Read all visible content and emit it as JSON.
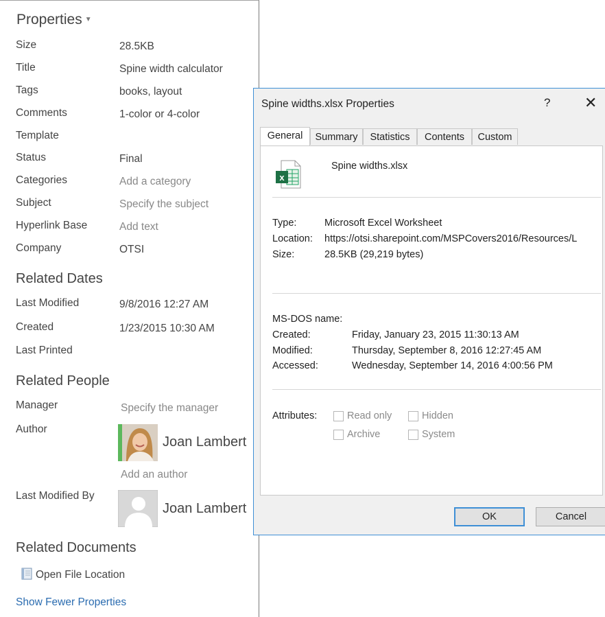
{
  "panel": {
    "title": "Properties",
    "properties": [
      {
        "label": "Size",
        "value": "28.5KB",
        "placeholder": false
      },
      {
        "label": "Title",
        "value": "Spine width calculator",
        "placeholder": false
      },
      {
        "label": "Tags",
        "value": "books, layout",
        "placeholder": false
      },
      {
        "label": "Comments",
        "value": "1-color or 4-color",
        "placeholder": false
      },
      {
        "label": "Template",
        "value": "",
        "placeholder": false
      },
      {
        "label": "Status",
        "value": "Final",
        "placeholder": false
      },
      {
        "label": "Categories",
        "value": "Add a category",
        "placeholder": true
      },
      {
        "label": "Subject",
        "value": "Specify the subject",
        "placeholder": true
      },
      {
        "label": "Hyperlink Base",
        "value": "Add text",
        "placeholder": true
      },
      {
        "label": "Company",
        "value": "OTSI",
        "placeholder": false
      }
    ],
    "related_dates": {
      "heading": "Related Dates",
      "items": [
        {
          "label": "Last Modified",
          "value": "9/8/2016 12:27 AM"
        },
        {
          "label": "Created",
          "value": "1/23/2015 10:30 AM"
        },
        {
          "label": "Last Printed",
          "value": ""
        }
      ]
    },
    "related_people": {
      "heading": "Related People",
      "manager_label": "Manager",
      "manager_placeholder": "Specify the manager",
      "author_label": "Author",
      "author_name": "Joan Lambert",
      "add_author": "Add an author",
      "last_modified_by_label": "Last Modified By",
      "last_modified_by_name": "Joan Lambert"
    },
    "related_documents": {
      "heading": "Related Documents",
      "open_file_location": "Open File Location"
    },
    "show_fewer": "Show Fewer Properties"
  },
  "dialog": {
    "title": "Spine widths.xlsx Properties",
    "help": "?",
    "close": "✕",
    "tabs": [
      "General",
      "Summary",
      "Statistics",
      "Contents",
      "Custom"
    ],
    "active_tab": "General",
    "file_name": "Spine widths.xlsx",
    "file_icon": "excel-file-icon",
    "info": [
      {
        "label": "Type:",
        "value": "Microsoft Excel Worksheet"
      },
      {
        "label": "Location:",
        "value": "https://otsi.sharepoint.com/MSPCovers2016/Resources/L"
      },
      {
        "label": "Size:",
        "value": "28.5KB (29,219 bytes)"
      }
    ],
    "dates": [
      {
        "label": "MS-DOS name:",
        "value": ""
      },
      {
        "label": "Created:",
        "value": "Friday, January 23, 2015 11:30:13 AM"
      },
      {
        "label": "Modified:",
        "value": "Thursday, September 8, 2016 12:27:45 AM"
      },
      {
        "label": "Accessed:",
        "value": "Wednesday, September 14, 2016 4:00:56 PM"
      }
    ],
    "attributes_label": "Attributes:",
    "attributes": [
      {
        "label": "Read only",
        "checked": false
      },
      {
        "label": "Hidden",
        "checked": false
      },
      {
        "label": "Archive",
        "checked": false
      },
      {
        "label": "System",
        "checked": false
      }
    ],
    "ok": "OK",
    "cancel": "Cancel"
  },
  "colors": {
    "accent": "#3d8fd6",
    "link": "#2b6cb0",
    "excel_green": "#1e7145"
  }
}
